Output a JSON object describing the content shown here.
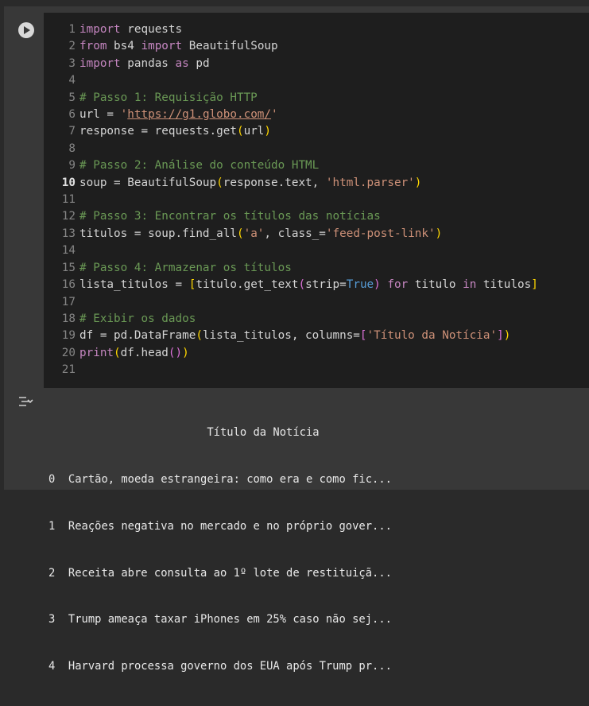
{
  "code_lines": [
    {
      "n": "1",
      "html": "<span class='kw'>import</span> requests"
    },
    {
      "n": "2",
      "html": "<span class='kw'>from</span> bs4 <span class='kw'>import</span> BeautifulSoup"
    },
    {
      "n": "3",
      "html": "<span class='kw'>import</span> pandas <span class='kw'>as</span> pd"
    },
    {
      "n": "4",
      "html": ""
    },
    {
      "n": "5",
      "html": "<span class='cm'># Passo 1: Requisição HTTP</span>"
    },
    {
      "n": "6",
      "html": "url = <span class='st'>'</span><span class='url'>https://g1.globo.com/</span><span class='st'>'</span>"
    },
    {
      "n": "7",
      "html": "response = requests.get<span class='br1'>(</span>url<span class='br1'>)</span>"
    },
    {
      "n": "8",
      "html": ""
    },
    {
      "n": "9",
      "html": "<span class='cm'># Passo 2: Análise do conteúdo HTML</span>"
    },
    {
      "n": "10",
      "html": "soup = BeautifulSoup<span class='br1'>(</span>response.text, <span class='st'>'html.parser'</span><span class='br1'>)</span>",
      "active": true
    },
    {
      "n": "11",
      "html": ""
    },
    {
      "n": "12",
      "html": "<span class='cm'># Passo 3: Encontrar os títulos das notícias</span>"
    },
    {
      "n": "13",
      "html": "titulos = soup.find_all<span class='br1'>(</span><span class='st'>'a'</span>, class_=<span class='st'>'feed-post-link'</span><span class='br1'>)</span>"
    },
    {
      "n": "14",
      "html": ""
    },
    {
      "n": "15",
      "html": "<span class='cm'># Passo 4: Armazenar os títulos</span>"
    },
    {
      "n": "16",
      "html": "lista_titulos = <span class='br1'>[</span>titulo.get_text<span class='br2'>(</span>strip=<span class='bl'>True</span><span class='br2'>)</span> <span class='kw'>for</span> titulo <span class='kw'>in</span> titulos<span class='br1'>]</span>"
    },
    {
      "n": "17",
      "html": ""
    },
    {
      "n": "18",
      "html": "<span class='cm'># Exibir os dados</span>"
    },
    {
      "n": "19",
      "html": "df = pd.DataFrame<span class='br1'>(</span>lista_titulos, columns=<span class='br2'>[</span><span class='st'>'Título da Notícia'</span><span class='br2'>]</span><span class='br1'>)</span>"
    },
    {
      "n": "20",
      "html": "<span class='kw'>print</span><span class='br1'>(</span>df.head<span class='br2'>()</span><span class='br1'>)</span>"
    },
    {
      "n": "21",
      "html": ""
    }
  ],
  "output": {
    "header": "                        Título da Notícia",
    "rows": [
      "0  Cartão, moeda estrangeira: como era e como fic...",
      "1  Reações negativa no mercado e no próprio gover...",
      "2  Receita abre consulta ao 1º lote de restituiçã...",
      "3  Trump ameaça taxar iPhones em 25% caso não sej...",
      "4  Harvard processa governo dos EUA após Trump pr..."
    ]
  }
}
